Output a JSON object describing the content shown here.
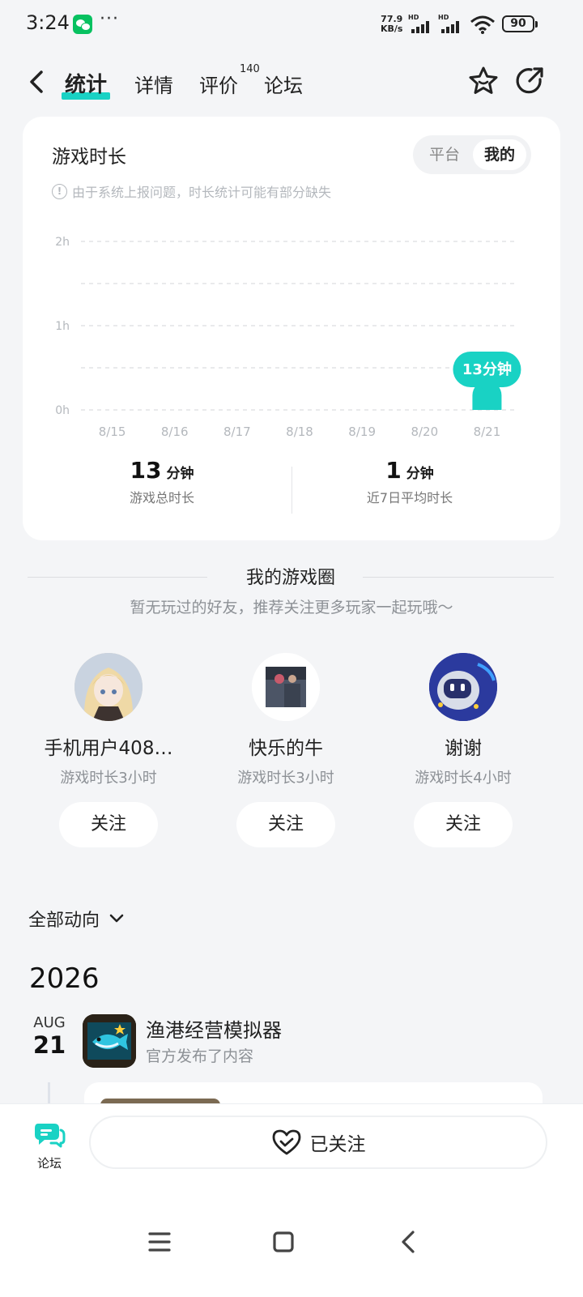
{
  "status_bar": {
    "time": "3:24",
    "more": "···",
    "net_speed_value": "77.9",
    "net_speed_unit": "KB/s",
    "hd": "HD",
    "battery": "90"
  },
  "nav": {
    "tabs": [
      {
        "label": "统计",
        "active": true
      },
      {
        "label": "详情",
        "active": false
      },
      {
        "label": "评价",
        "active": false
      },
      {
        "label": "论坛",
        "active": false
      }
    ],
    "review_count": "140"
  },
  "stats_card": {
    "title": "游戏时长",
    "toggle": [
      "平台",
      "我的"
    ],
    "toggle_selected": "我的",
    "notice": "由于系统上报问题，时长统计可能有部分缺失",
    "total": {
      "value": "13",
      "unit": "分钟",
      "label": "游戏总时长"
    },
    "average": {
      "value": "1",
      "unit": "分钟",
      "label": "近7日平均时长"
    }
  },
  "chart_data": {
    "type": "bar",
    "categories": [
      "8/15",
      "8/16",
      "8/17",
      "8/18",
      "8/19",
      "8/20",
      "8/21"
    ],
    "values": [
      0,
      0,
      0,
      0,
      0,
      0,
      13
    ],
    "unit": "minutes",
    "y_ticks": [
      "0h",
      "1h",
      "2h"
    ],
    "ylim": [
      0,
      120
    ],
    "grid": true,
    "callout": "13分钟",
    "bar_color": "#19d2c4"
  },
  "circle": {
    "title": "我的游戏圈",
    "subtitle": "暂无玩过的好友，推荐关注更多玩家一起玩哦～",
    "friends": [
      {
        "name": "手机用户408…",
        "playtime": "游戏时长3小时",
        "button": "关注"
      },
      {
        "name": "快乐的牛",
        "playtime": "游戏时长3小时",
        "button": "关注"
      },
      {
        "name": "谢谢",
        "playtime": "游戏时长4小时",
        "button": "关注"
      }
    ]
  },
  "feed": {
    "filter": "全部动向",
    "year": "2026",
    "items": [
      {
        "month": "AUG",
        "day": "21",
        "game": "渔港经营模拟器",
        "action": "官方发布了内容"
      }
    ]
  },
  "bottom": {
    "forum_label": "论坛",
    "follow_label": "已关注"
  },
  "colors": {
    "accent": "#19d2c4",
    "background": "#f4f5f7"
  }
}
